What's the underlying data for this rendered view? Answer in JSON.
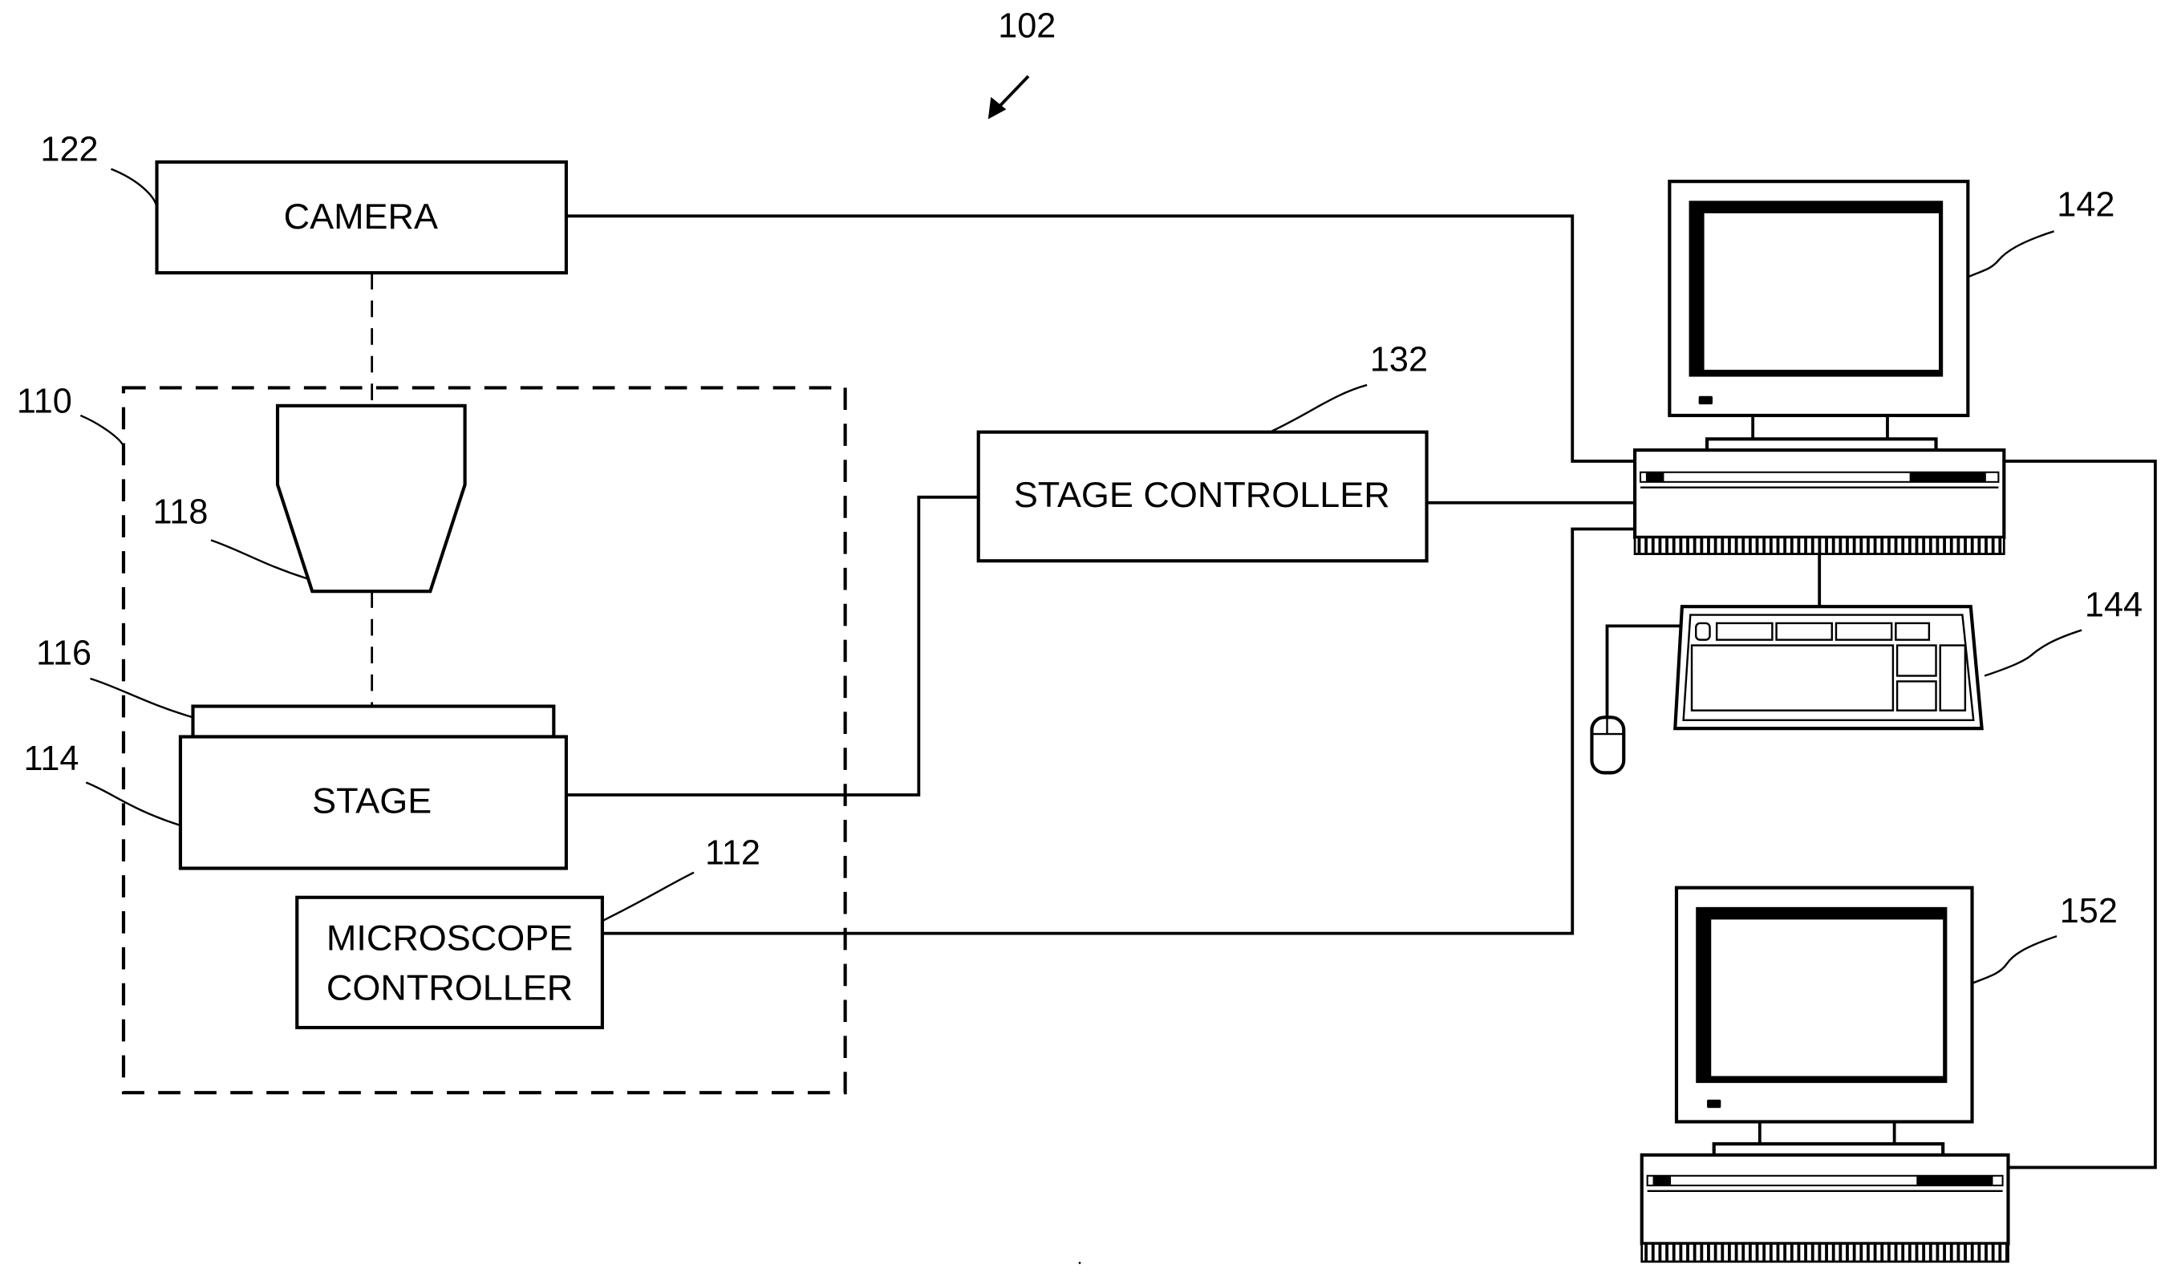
{
  "figure": {
    "reference_numeral": "102",
    "type": "microscope imaging system block diagram"
  },
  "components": {
    "camera": {
      "label": "CAMERA",
      "ref": "122"
    },
    "microscope": {
      "ref": "110"
    },
    "objective": {
      "ref": "118"
    },
    "slide": {
      "ref": "116"
    },
    "stage": {
      "label": "STAGE",
      "ref": "114"
    },
    "microscope_controller": {
      "label_line1": "MICROSCOPE",
      "label_line2": "CONTROLLER",
      "ref": "112"
    },
    "stage_controller": {
      "label": "STAGE CONTROLLER",
      "ref": "132"
    },
    "computer_primary": {
      "ref": "142"
    },
    "keyboard": {
      "ref": "144"
    },
    "computer_secondary": {
      "ref": "152"
    }
  },
  "connections": [
    {
      "from": "camera",
      "to": "computer_primary"
    },
    {
      "from": "stage",
      "to": "stage_controller"
    },
    {
      "from": "stage_controller",
      "to": "computer_primary"
    },
    {
      "from": "microscope_controller",
      "to": "computer_primary"
    },
    {
      "from": "computer_primary",
      "to": "keyboard"
    },
    {
      "from": "keyboard",
      "to": "mouse"
    },
    {
      "from": "computer_primary",
      "to": "computer_secondary"
    },
    {
      "from": "camera",
      "to": "objective",
      "style": "optical-path"
    }
  ]
}
